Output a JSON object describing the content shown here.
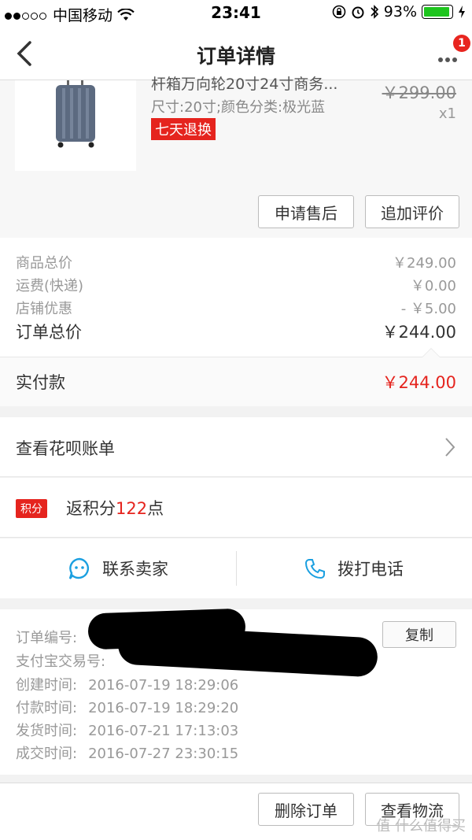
{
  "status_bar": {
    "carrier": "中国移动",
    "time": "23:41",
    "battery": "93%",
    "battery_level": 0.93
  },
  "nav": {
    "title": "订单详情",
    "badge_count": "1"
  },
  "product": {
    "name": "杆箱万向轮20寸24寸商务...",
    "spec": "尺寸:20寸;颜色分类:极光蓝",
    "tag": "七天退换",
    "original_price": "￥299.00",
    "quantity": "x1",
    "buttons": {
      "after_sales": "申请售后",
      "add_review": "追加评价"
    }
  },
  "prices": {
    "goods_total_label": "商品总价",
    "goods_total_value": "￥249.00",
    "shipping_label": "运费(快递)",
    "shipping_value": "￥0.00",
    "discount_label": "店铺优惠",
    "discount_value": "- ￥5.00",
    "order_total_label": "订单总价",
    "order_total_value": "￥244.00",
    "paid_label": "实付款",
    "paid_value": "￥244.00"
  },
  "huabei": {
    "label": "查看花呗账单"
  },
  "points": {
    "tag": "积分",
    "prefix": "返积分",
    "number": "122",
    "suffix": "点"
  },
  "contact": {
    "seller": "联系卖家",
    "call": "拨打电话"
  },
  "order_info": {
    "order_no_label": "订单编号:",
    "alipay_no_label": "支付宝交易号:",
    "copy": "复制",
    "created_label": "创建时间:",
    "created_value": "2016-07-19 18:29:06",
    "paid_label": "付款时间:",
    "paid_value": "2016-07-19 18:29:20",
    "shipped_label": "发货时间:",
    "shipped_value": "2016-07-21 17:13:03",
    "done_label": "成交时间:",
    "done_value": "2016-07-27 23:30:15"
  },
  "bottom": {
    "delete_order": "删除订单",
    "track_logistics": "查看物流",
    "watermark": "值 什么值得买"
  },
  "colors": {
    "accent_red": "#e5241e",
    "blue_icon": "#1a9fe0"
  }
}
